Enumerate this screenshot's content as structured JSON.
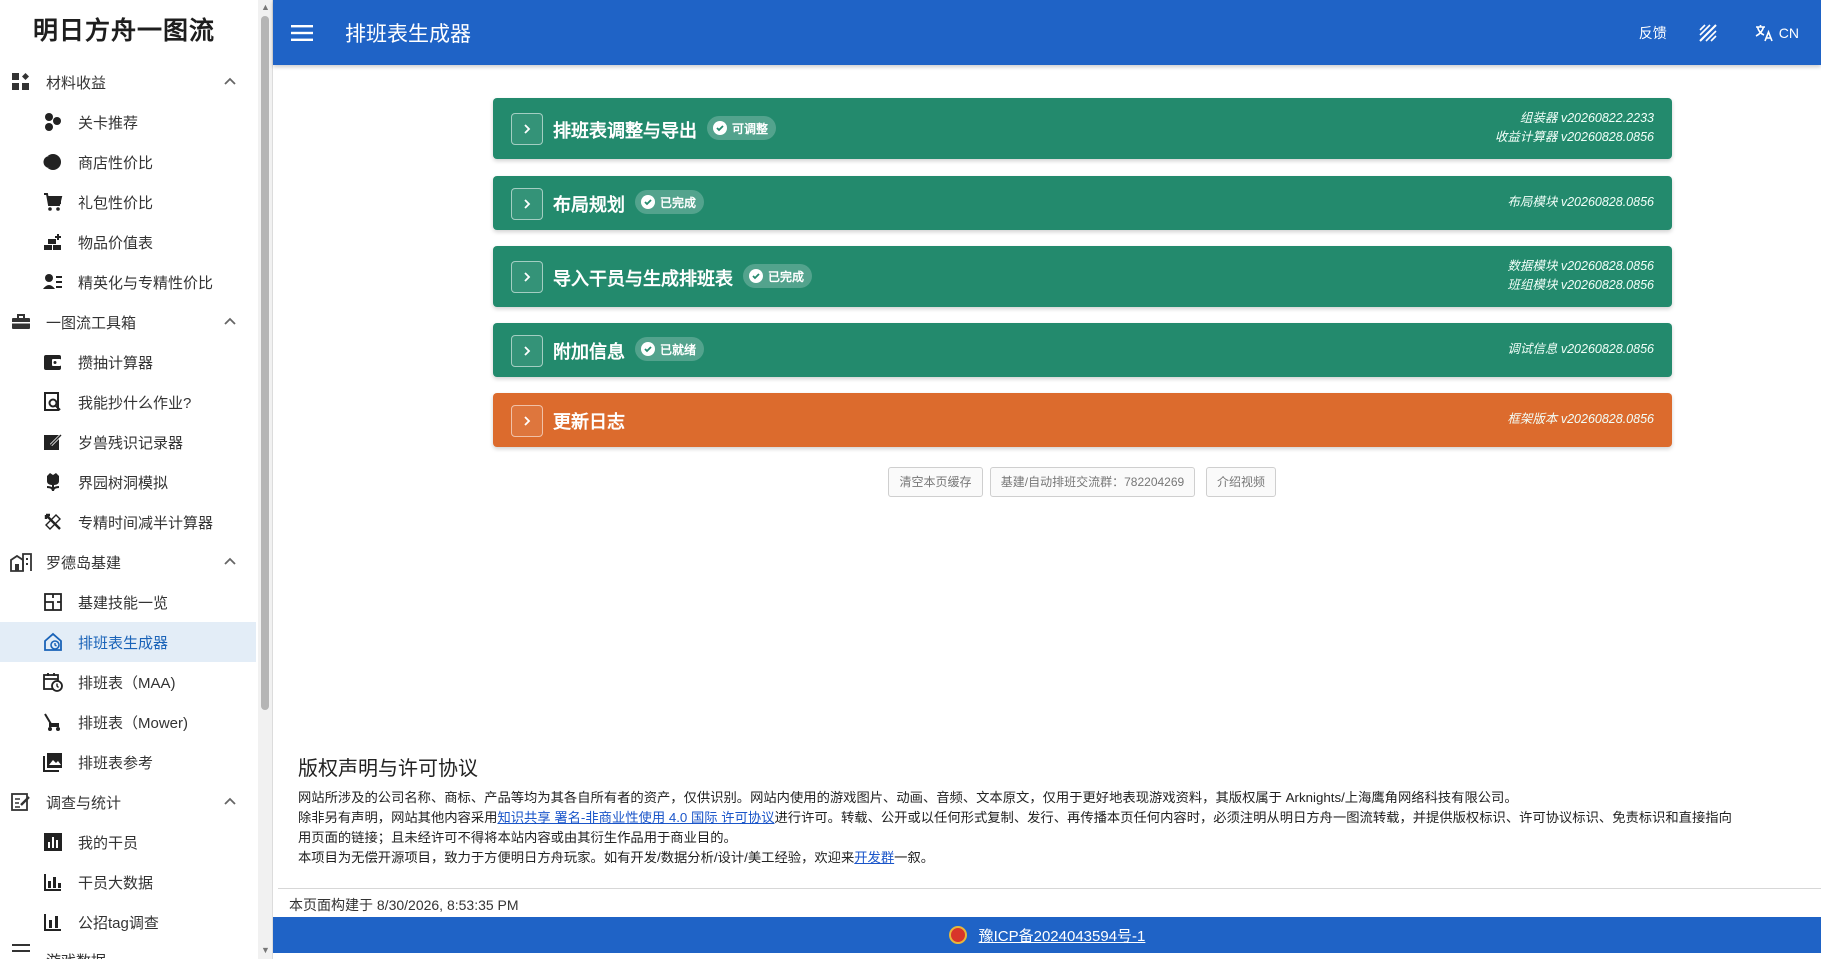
{
  "sidebar": {
    "brand": "明日方舟一图流",
    "sections": [
      {
        "label": "材料收益",
        "items": [
          "关卡推荐",
          "商店性价比",
          "礼包性价比",
          "物品价值表",
          "精英化与专精性价比"
        ]
      },
      {
        "label": "一图流工具箱",
        "items": [
          "攒抽计算器",
          "我能抄什么作业?",
          "岁兽残识记录器",
          "界园树洞模拟",
          "专精时间减半计算器"
        ]
      },
      {
        "label": "罗德岛基建",
        "items": [
          "基建技能一览",
          "排班表生成器",
          "排班表（MAA)",
          "排班表（Mower)",
          "排班表参考"
        ]
      },
      {
        "label": "调查与统计",
        "items": [
          "我的干员",
          "干员大数据",
          "公招tag调查"
        ]
      },
      {
        "label": "游戏数据",
        "items": []
      }
    ],
    "active_item": "排班表生成器"
  },
  "topbar": {
    "title": "排班表生成器",
    "feedback": "反馈",
    "lang": "CN"
  },
  "panels": [
    {
      "title": "排班表调整与导出",
      "chip": "可调整",
      "versions": [
        "组装器 v20260822.2233",
        "收益计算器 v20260828.0856"
      ],
      "color": "#238a6d"
    },
    {
      "title": "布局规划",
      "chip": "已完成",
      "versions": [
        "布局模块 v20260828.0856"
      ],
      "color": "#238a6d"
    },
    {
      "title": "导入干员与生成排班表",
      "chip": "已完成",
      "versions": [
        "数据模块 v20260828.0856",
        "班组模块 v20260828.0856"
      ],
      "color": "#238a6d"
    },
    {
      "title": "附加信息",
      "chip": "已就绪",
      "versions": [
        "调试信息 v20260828.0856"
      ],
      "color": "#238a6d"
    },
    {
      "title": "更新日志",
      "chip": "",
      "versions": [
        "框架版本 v20260828.0856"
      ],
      "color": "#dc6b2d"
    }
  ],
  "buttons": {
    "clear_cache": "清空本页缓存",
    "group": "基建/自动排班交流群：782204269",
    "video": "介绍视频"
  },
  "copyright": {
    "heading": "版权声明与许可协议",
    "line1": "网站所涉及的公司名称、商标、产品等均为其各自所有者的资产，仅供识别。网站内使用的游戏图片、动画、音频、文本原文，仅用于更好地表现游戏资料，其版权属于 Arknights/上海鹰角网络科技有限公司。",
    "line2_pre": "除非另有声明，网站其他内容采用",
    "license_link": "知识共享 署名-非商业性使用 4.0 国际 许可协议",
    "line2_post": "进行许可。转载、公开或以任何形式复制、发行、再传播本页任何内容时，必须注明从明日方舟一图流转载，并提供版权标识、许可协议标识、免责标识和直接指向",
    "line3": "用页面的链接；且未经许可不得将本站内容或由其衍生作品用于商业目的。",
    "line4_pre": "本项目为无偿开源项目，致力于方便明日方舟玩家。如有开发/数据分析/设计/美工经验，欢迎来",
    "dev_link": "开发群",
    "line4_post": "一叙。"
  },
  "build_time": "本页面构建于 8/30/2026, 8:53:35 PM",
  "icp": "豫ICP备2024043594号-1",
  "colors": {
    "primary": "#1f63c6",
    "green": "#238a6d",
    "orange": "#dc6b2d",
    "active_bg": "#e3edf7"
  }
}
